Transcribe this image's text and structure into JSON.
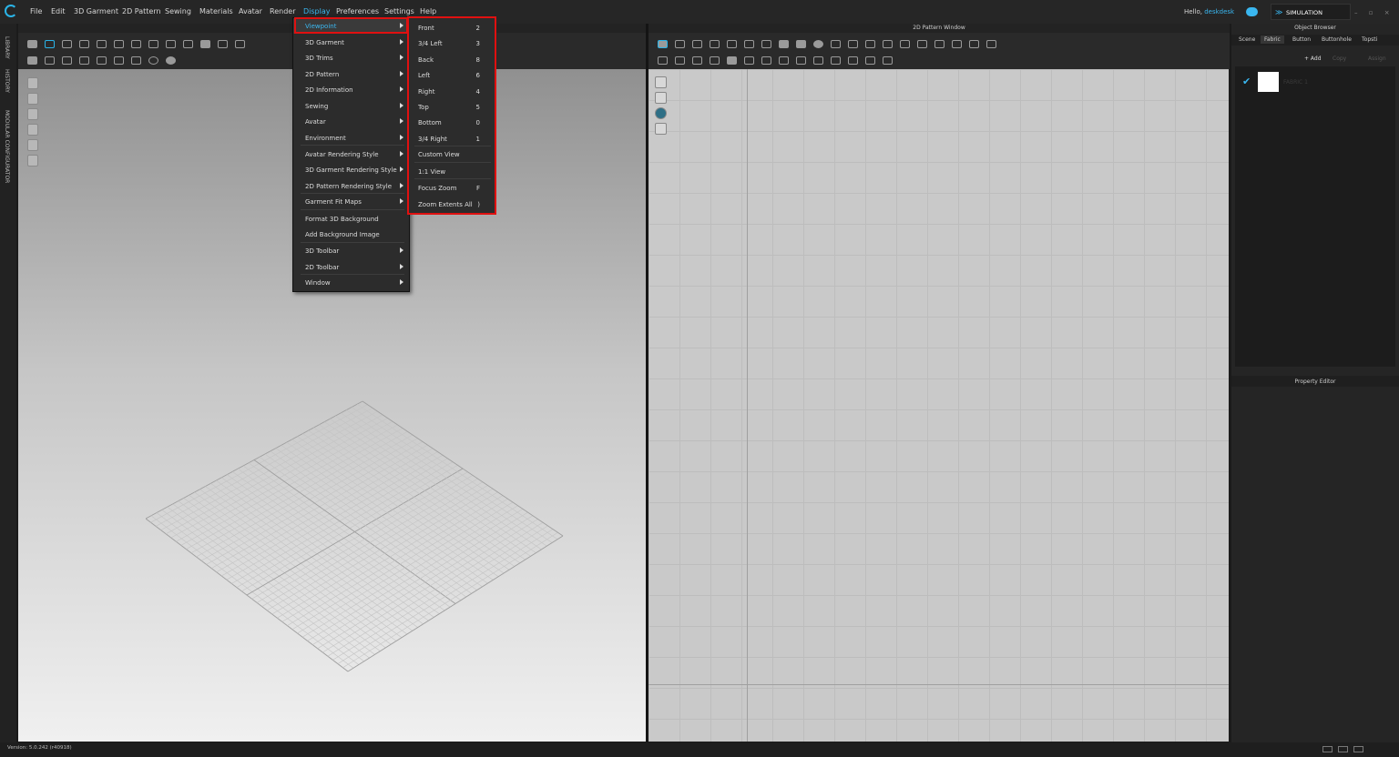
{
  "menubar": {
    "items": [
      "File",
      "Edit",
      "3D Garment",
      "2D Pattern",
      "Sewing",
      "Materials",
      "Avatar",
      "Render",
      "Display",
      "Preferences",
      "Settings",
      "Help"
    ],
    "active": "Display",
    "greeting": "Hello,",
    "username": "deskdesk",
    "mode": "SIMULATION",
    "window_controls": "– ▫ ×"
  },
  "left_tabs": [
    "LIBRARY",
    "HISTORY",
    "MODULAR CONFIGURATOR"
  ],
  "pattern_window": {
    "title": "2D Pattern Window"
  },
  "object_browser": {
    "title": "Object Browser",
    "tabs": [
      "Scene",
      "Fabric",
      "Button",
      "Buttonhole",
      "Topsti"
    ],
    "active_tab": "Fabric",
    "actions": [
      "+ Add",
      "Copy",
      "Assign"
    ],
    "fabric_name": "FABRIC 1"
  },
  "property_editor": {
    "title": "Property Editor"
  },
  "status": {
    "version": "Version: 5.0.242 (r40918)"
  },
  "display_menu": {
    "items": [
      {
        "label": "Viewpoint",
        "submenu": true
      },
      {
        "label": "3D Garment",
        "submenu": true
      },
      {
        "label": "3D Trims",
        "submenu": true
      },
      {
        "label": "2D Pattern",
        "submenu": true
      },
      {
        "label": "2D Information",
        "submenu": true
      },
      {
        "label": "Sewing",
        "submenu": true
      },
      {
        "label": "Avatar",
        "submenu": true
      },
      {
        "label": "Environment",
        "submenu": true
      },
      {
        "label": "Avatar Rendering Style",
        "submenu": true
      },
      {
        "label": "3D Garment Rendering Style",
        "submenu": true
      },
      {
        "label": "2D Pattern Rendering Style",
        "submenu": true
      },
      {
        "label": "Garment Fit Maps",
        "submenu": true
      },
      {
        "label": "Format 3D Background",
        "submenu": false
      },
      {
        "label": "Add Background Image",
        "submenu": false
      },
      {
        "label": "3D Toolbar",
        "submenu": true
      },
      {
        "label": "2D Toolbar",
        "submenu": true
      },
      {
        "label": "Window",
        "submenu": true
      }
    ]
  },
  "viewpoint_menu": {
    "items": [
      {
        "label": "Front",
        "key": "2"
      },
      {
        "label": "3/4 Left",
        "key": "3"
      },
      {
        "label": "Back",
        "key": "8"
      },
      {
        "label": "Left",
        "key": "6"
      },
      {
        "label": "Right",
        "key": "4"
      },
      {
        "label": "Top",
        "key": "5"
      },
      {
        "label": "Bottom",
        "key": "0"
      },
      {
        "label": "3/4 Right",
        "key": "1"
      },
      {
        "label": "Custom View",
        "key": ""
      },
      {
        "label": "1:1 View",
        "key": ""
      },
      {
        "label": "Focus Zoom",
        "key": "F"
      },
      {
        "label": "Zoom Extents All",
        "key": ")"
      }
    ]
  },
  "colors": {
    "accent": "#3ab7f0",
    "highlight_border": "#e01010",
    "menu_bg": "#2c2c2c"
  }
}
